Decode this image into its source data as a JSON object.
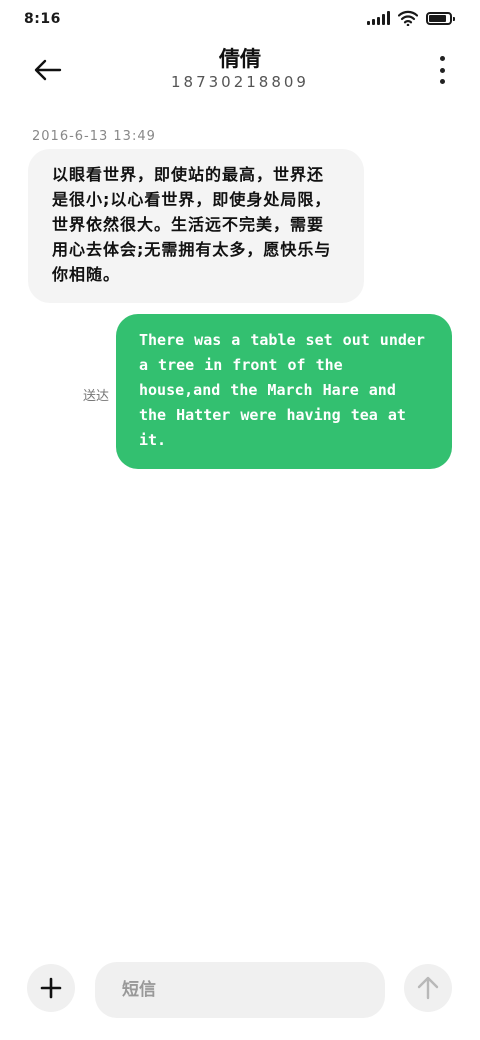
{
  "status_bar": {
    "time": "8:16",
    "battery_level": 0.85,
    "signal_icon": "cell-signal-icon",
    "wifi_icon": "wifi-icon",
    "battery_icon": "battery-icon"
  },
  "header": {
    "contact_name": "倩倩",
    "contact_number": "18730218809",
    "back_icon": "arrow-left-icon",
    "more_icon": "more-vertical-icon"
  },
  "conversation": {
    "timestamp": "2016-6-13 13:49",
    "incoming_message": "以眼看世界，即使站的最高，世界还是很小;以心看世界，即使身处局限，世界依然很大。生活远不完美，需要用心去体会;无需拥有太多，愿快乐与你相随。",
    "outgoing_message": "There was a table set out under a tree in front of the house,and the March Hare and the Hatter were having tea at it.",
    "outgoing_status": "送达"
  },
  "input_bar": {
    "placeholder": "短信",
    "value": "",
    "add_icon": "plus-icon",
    "send_icon": "arrow-up-icon"
  },
  "colors": {
    "outgoing_bubble": "#33c070",
    "incoming_bubble": "#f4f4f4",
    "input_background": "#f0f0f0"
  }
}
